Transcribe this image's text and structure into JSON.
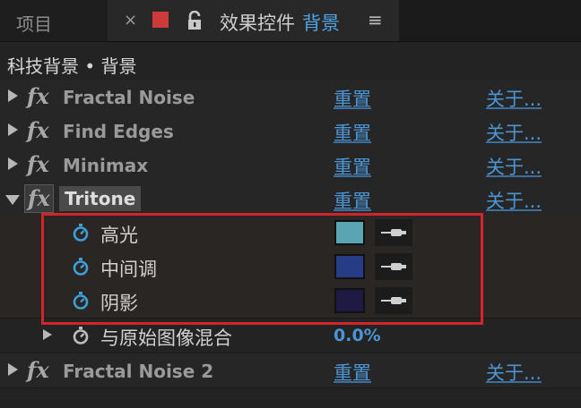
{
  "tabs": {
    "project_label": "项目",
    "close_glyph": "×",
    "panel_title": "效果控件",
    "layer_name": "背景",
    "menu_glyph": "≡"
  },
  "breadcrumb": "科技背景 • 背景",
  "effects": [
    {
      "name": "Fractal Noise",
      "fx": "fx",
      "reset": "重置",
      "about": "关于..."
    },
    {
      "name": "Find Edges",
      "fx": "fx",
      "reset": "重置",
      "about": "关于..."
    },
    {
      "name": "Minimax",
      "fx": "fx",
      "reset": "重置",
      "about": "关于..."
    },
    {
      "name": "Tritone",
      "fx": "fx",
      "reset": "重置",
      "about": "关于..."
    },
    {
      "name": "Fractal Noise 2",
      "fx": "fx",
      "reset": "重置",
      "about": "关于..."
    }
  ],
  "tritone_params": [
    {
      "label": "高光",
      "color": "#5aa5b3"
    },
    {
      "label": "中间调",
      "color": "#263d85"
    },
    {
      "label": "阴影",
      "color": "#1e1a44"
    }
  ],
  "blend": {
    "label": "与原始图像混合",
    "value": "0.0%"
  },
  "colors": {
    "accent": "#4c95d4",
    "highlight": "#d2242b",
    "label_color": "#cc3a3a"
  }
}
